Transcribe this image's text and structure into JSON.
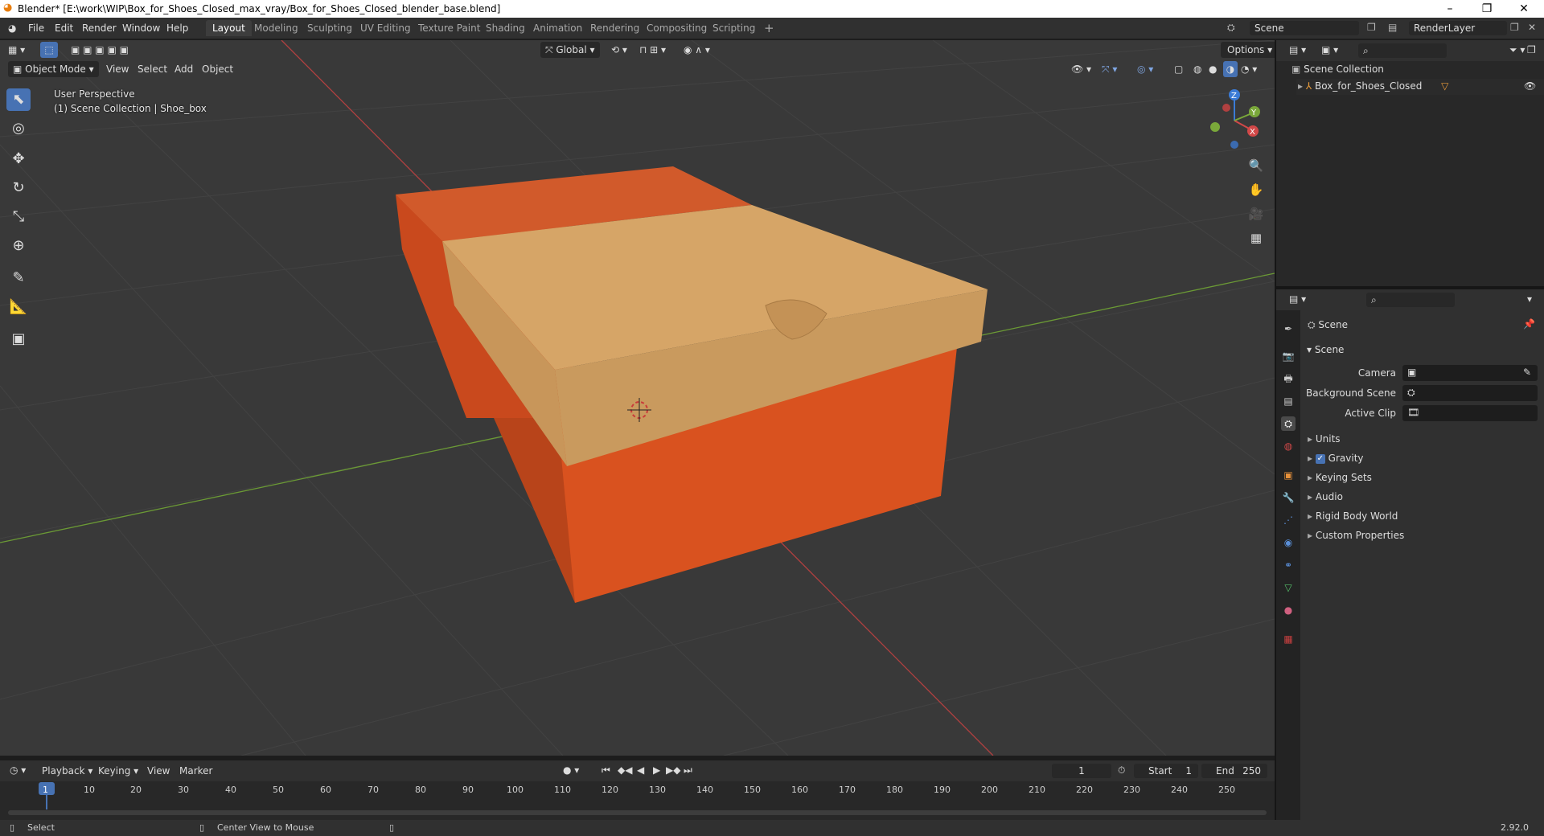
{
  "window": {
    "title": "Blender* [E:\\work\\WIP\\Box_for_Shoes_Closed_max_vray/Box_for_Shoes_Closed_blender_base.blend]",
    "minimize": "–",
    "maximize": "❐",
    "close": "✕"
  },
  "menu": {
    "items": [
      "File",
      "Edit",
      "Render",
      "Window",
      "Help"
    ]
  },
  "workspaces": {
    "tabs": [
      "Layout",
      "Modeling",
      "Sculpting",
      "UV Editing",
      "Texture Paint",
      "Shading",
      "Animation",
      "Rendering",
      "Compositing",
      "Scripting"
    ],
    "add": "+"
  },
  "scene_selector": {
    "value": "Scene"
  },
  "renderlayer_selector": {
    "value": "RenderLayer"
  },
  "viewport": {
    "transform_orientation": "Global",
    "options": "Options",
    "mode": "Object Mode",
    "menus": [
      "View",
      "Select",
      "Add",
      "Object"
    ],
    "info_line1": "User Perspective",
    "info_line2": "(1) Scene Collection | Shoe_box",
    "gizmo": {
      "x": "X",
      "y": "Y",
      "z": "Z"
    }
  },
  "outliner": {
    "root": "Scene Collection",
    "items": [
      {
        "label": "Box_for_Shoes_Closed"
      }
    ]
  },
  "properties": {
    "header_title": "Scene",
    "panel_title": "Scene",
    "fields": [
      {
        "label": "Camera"
      },
      {
        "label": "Background Scene"
      },
      {
        "label": "Active Clip"
      }
    ],
    "sections": [
      "Units",
      "Gravity",
      "Keying Sets",
      "Audio",
      "Rigid Body World",
      "Custom Properties"
    ],
    "gravity_checked": true
  },
  "timeline": {
    "menus": [
      "Playback",
      "Keying",
      "View",
      "Marker"
    ],
    "current_frame": "1",
    "start_label": "Start",
    "start_value": "1",
    "end_label": "End",
    "end_value": "250",
    "ticks": [
      "1",
      "10",
      "20",
      "30",
      "40",
      "50",
      "60",
      "70",
      "80",
      "90",
      "100",
      "110",
      "120",
      "130",
      "140",
      "150",
      "160",
      "170",
      "180",
      "190",
      "200",
      "210",
      "220",
      "230",
      "240",
      "250"
    ]
  },
  "statusbar": {
    "left": "Select",
    "middle": "Center View to Mouse",
    "version": "2.92.0"
  },
  "colors": {
    "accent": "#4772b3",
    "box_orange": "#d9521f",
    "lid_tan": "#d6a567",
    "x_axis": "#c94545",
    "y_axis": "#7aa83a"
  }
}
